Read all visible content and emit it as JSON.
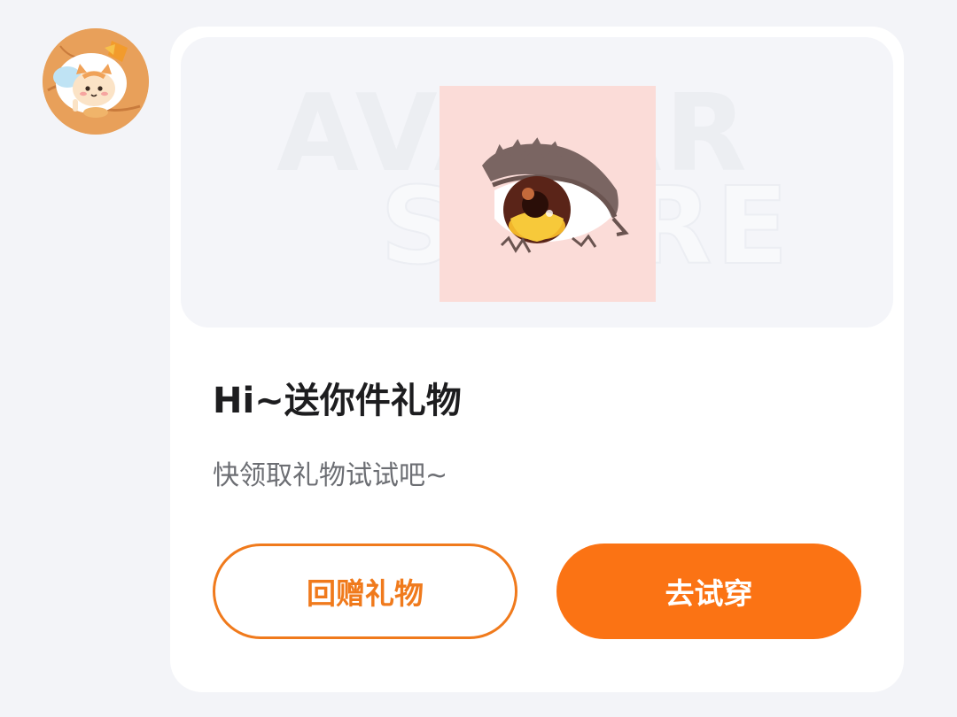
{
  "colors": {
    "accent": "#fb7314",
    "accent_outline": "#f07a1c",
    "background": "#f3f4f8",
    "card": "#ffffff",
    "gift_bg": "#fbdcd8"
  },
  "sender": {
    "avatar_icon": "cat-avatar-icon"
  },
  "banner": {
    "watermark_line1": "AVATAR",
    "watermark_line2": "STORE",
    "gift_icon": "eye-icon"
  },
  "message": {
    "title": "Hi~送你件礼物",
    "subtitle": "快领取礼物试试吧~"
  },
  "actions": {
    "return_gift_label": "回赠礼物",
    "try_on_label": "去试穿"
  }
}
